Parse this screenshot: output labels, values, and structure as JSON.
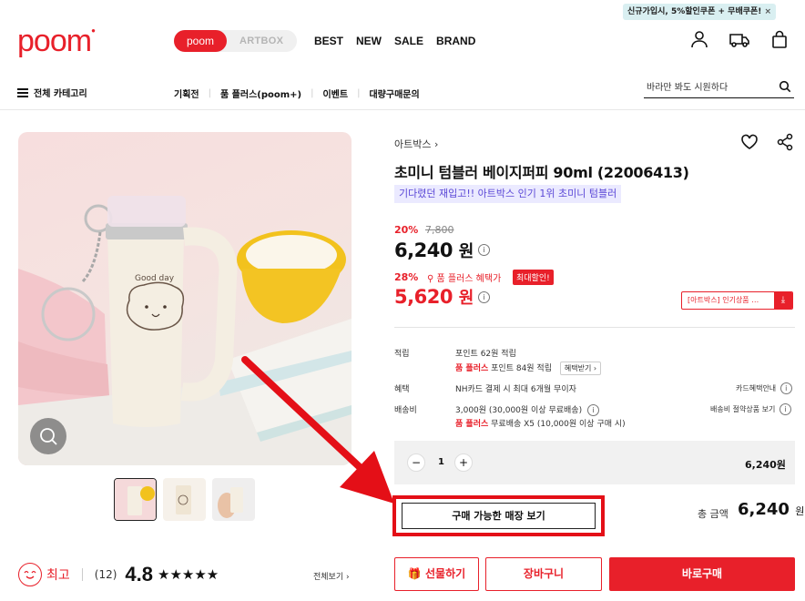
{
  "header": {
    "logo": "poom",
    "toggle": {
      "poom": "poom",
      "artbox": "ARTBOX"
    },
    "nav": [
      "BEST",
      "NEW",
      "SALE",
      "BRAND"
    ],
    "promo": "신규가입시, 5%할인쿠폰 + 무배쿠폰!",
    "promo_close": "×",
    "category_menu": "전체 카테고리",
    "subnav": [
      "기획전",
      "품 플러스(poom+)",
      "이벤트",
      "대량구매문의"
    ],
    "search_placeholder": "바라만 봐도 시원하다"
  },
  "product": {
    "brand": "아트박스 ›",
    "title": "초미니 텀블러 베이지퍼피 90ml (22006413)",
    "tagline": "기다렸던 재입고!! 아트박스 인기 1위 초미니 텀블러",
    "discount1": "20%",
    "original_price": "7,800",
    "price1": "6,240",
    "won": "원",
    "discount2": "28%",
    "plus_label": "품 플러스 혜택가",
    "badge": "최대할인!",
    "price2": "5,620",
    "coupon": "[아트박스] 인기상품 …",
    "image_text": "Good day"
  },
  "details": {
    "points_label": "적립",
    "points_line1": "포인트 62원 적립",
    "points_plus": "품 플러스",
    "points_line2": "포인트 84원 적립",
    "benefit_btn": "혜택받기 ›",
    "benefit_label": "혜택",
    "benefit_value": "NH카드 결제 시 최대 6개월 무이자",
    "card_link": "카드혜택안내",
    "shipping_label": "배송비",
    "shipping_line1": "3,000원 (30,000원 이상 무료배송)",
    "shipping_plus": "품 플러스",
    "shipping_line2": "무료배송 X5 (10,000원 이상 구매 시)",
    "shipping_link": "배송비 절약상품 보기"
  },
  "order": {
    "minus": "−",
    "quantity": "1",
    "plus": "+",
    "line_price": "6,240원",
    "store_button": "구매 가능한 매장 보기",
    "total_label": "총 금액",
    "total_value": "6,240",
    "total_unit": "원",
    "gift_button": "선물하기",
    "cart_button": "장바구니",
    "buy_button": "바로구매"
  },
  "rating": {
    "label": "최고",
    "count": "(12)",
    "score": "4.8",
    "stars": "★★★★★",
    "view_all": "전체보기 ›"
  },
  "colors": {
    "brand": "#e8202a",
    "annotation": "#e40f17",
    "restock_bg": "#ebeaff",
    "restock_text": "#5a47d6"
  }
}
